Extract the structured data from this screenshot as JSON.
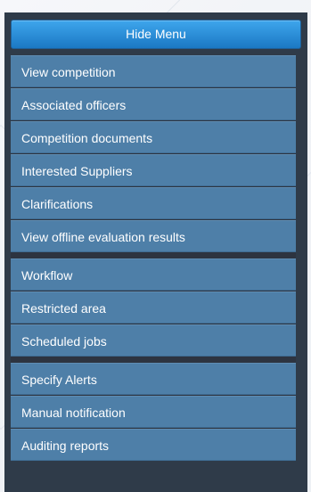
{
  "menu": {
    "hide_label": "Hide Menu",
    "sections": [
      [
        "View competition",
        "Associated officers",
        "Competition documents",
        "Interested Suppliers",
        "Clarifications",
        "View offline evaluation results"
      ],
      [
        "Workflow",
        "Restricted area",
        "Scheduled jobs"
      ],
      [
        "Specify Alerts",
        "Manual notification",
        "Auditing reports"
      ]
    ]
  },
  "left_fragment": "c"
}
